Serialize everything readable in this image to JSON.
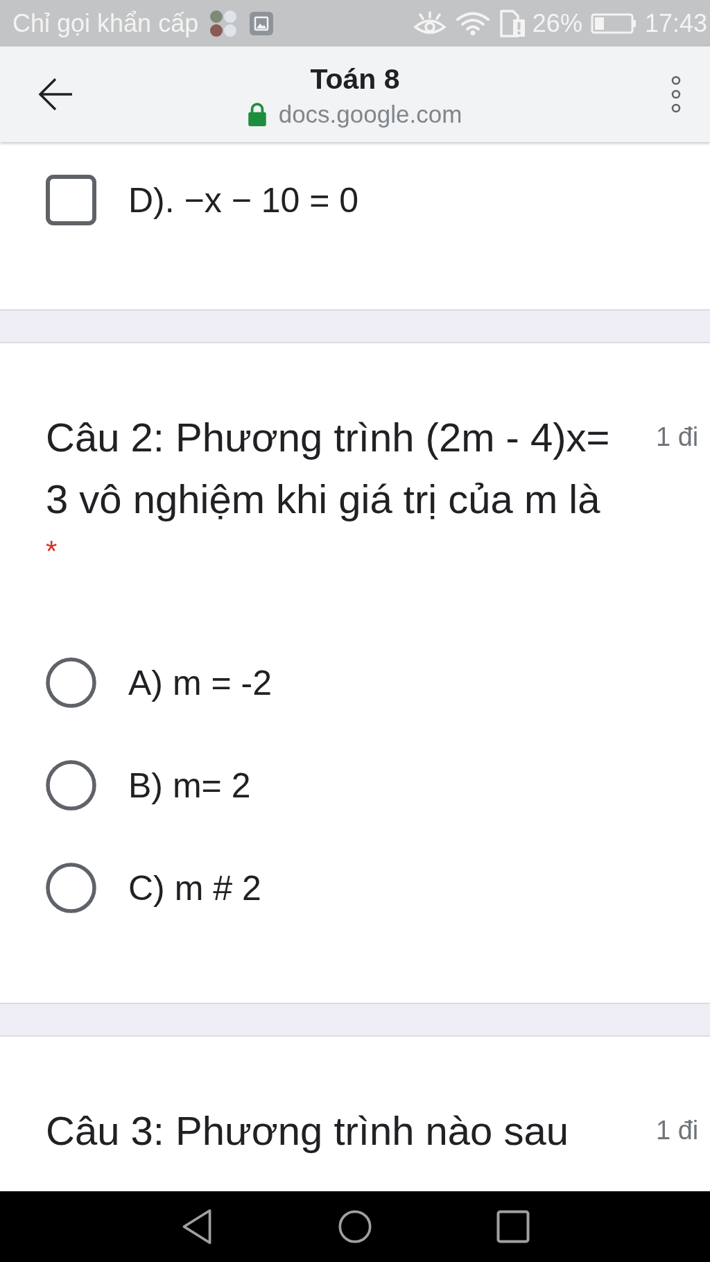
{
  "status_bar": {
    "notification_text": "Chỉ gọi khẩn cấp",
    "battery_percent": "26%",
    "time": "17:43"
  },
  "browser_bar": {
    "title": "Toán 8",
    "url": "docs.google.com"
  },
  "form": [
    {
      "kind": "continuation",
      "options": [
        {
          "kind": "checkbox",
          "label": "D). −x − 10 = 0",
          "checked": false
        }
      ]
    },
    {
      "kind": "question",
      "title": "Câu 2: Phương trình (2m - 4)x= 3 vô nghiệm khi giá trị của m là",
      "points": "1 đi",
      "required_mark": "*",
      "options": [
        {
          "kind": "radio",
          "label": "A) m = -2",
          "selected": false
        },
        {
          "kind": "radio",
          "label": "B) m= 2",
          "selected": false
        },
        {
          "kind": "radio",
          "label": "C) m # 2",
          "selected": false
        }
      ]
    },
    {
      "kind": "question",
      "title": "Câu 3: Phương trình nào sau",
      "points": "1 đi"
    }
  ]
}
